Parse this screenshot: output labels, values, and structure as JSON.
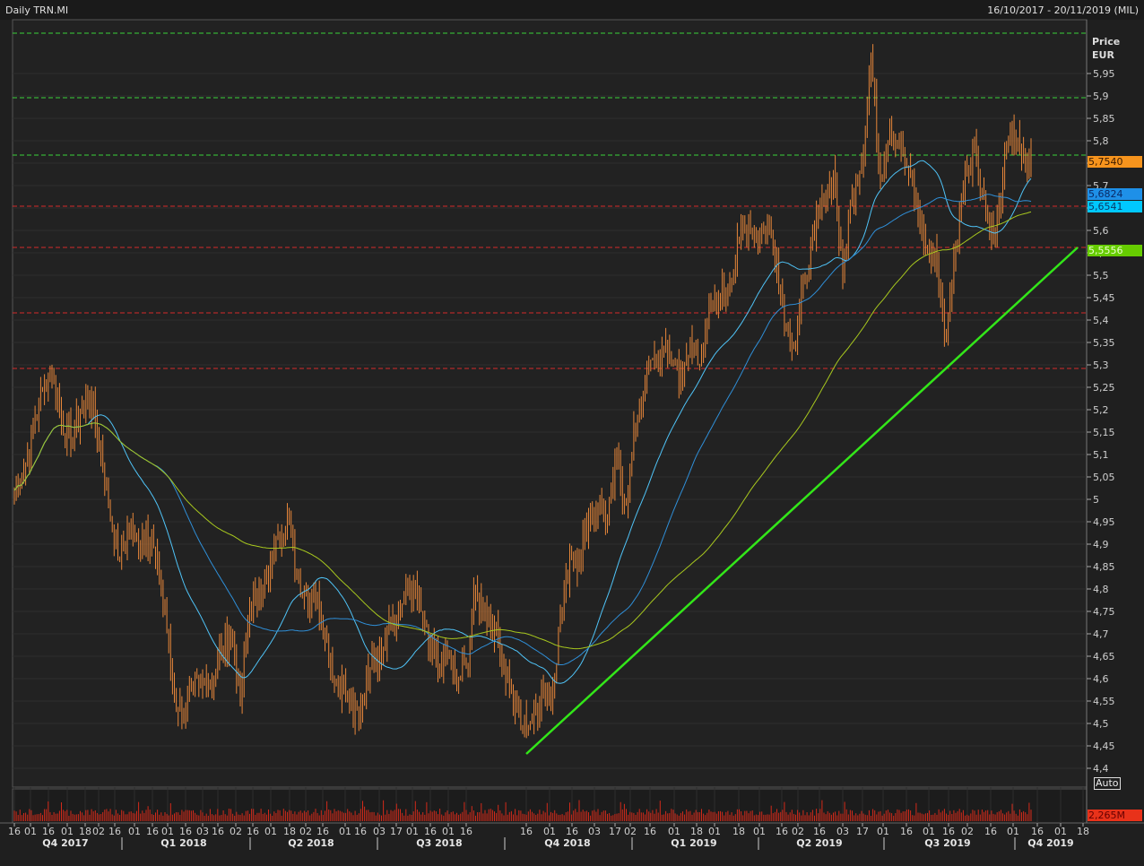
{
  "header": {
    "title": "Daily TRN.MI",
    "range": "16/10/2017 - 20/11/2019 (MIL)"
  },
  "chart_data": {
    "type": "line",
    "title": "Daily TRN.MI",
    "ylabel": "Price",
    "yunit": "EUR",
    "ylim": [
      4.35,
      6.05
    ],
    "yticks": [
      5.95,
      5.9,
      5.85,
      5.8,
      5.75,
      5.7,
      5.65,
      5.6,
      5.55,
      5.5,
      5.45,
      5.4,
      5.35,
      5.3,
      5.25,
      5.2,
      5.15,
      5.1,
      5.05,
      5.0,
      4.95,
      4.9,
      4.85,
      4.8,
      4.75,
      4.7,
      4.65,
      4.6,
      4.55,
      4.5,
      4.45,
      4.4
    ],
    "ytick_labels": [
      "5,95",
      "5,9",
      "5,85",
      "5,8",
      "5,75",
      "5,7",
      "5,65",
      "5,6",
      "5,55",
      "5,5",
      "5,45",
      "5,4",
      "5,35",
      "5,3",
      "5,25",
      "5,2",
      "5,15",
      "5,1",
      "5,05",
      "5",
      "4,95",
      "4,9",
      "4,85",
      "4,8",
      "4,75",
      "4,7",
      "4,65",
      "4,6",
      "4,55",
      "4,5",
      "4,45",
      "4,4"
    ],
    "x_day_labels": [
      "16",
      "01",
      "16",
      "01",
      "18",
      "02",
      "16",
      "01",
      "16",
      "01",
      "16",
      "03",
      "16",
      "02",
      "16",
      "01",
      "18",
      "02",
      "16",
      "01",
      "16",
      "03",
      "17",
      "01",
      "16",
      "01",
      "16",
      "16",
      "01",
      "16",
      "03",
      "17",
      "02",
      "16",
      "01",
      "18",
      "01",
      "18",
      "01",
      "16",
      "02",
      "16",
      "03",
      "17",
      "01",
      "16",
      "01",
      "16",
      "02",
      "16",
      "01",
      "16",
      "01",
      "18"
    ],
    "quarter_labels": [
      "Q4 2017",
      "Q1 2018",
      "Q2 2018",
      "Q3 2018",
      "Q4 2018",
      "Q1 2019",
      "Q2 2019",
      "Q3 2019",
      "Q4 2019"
    ],
    "weekly_close": [
      5.02,
      5.07,
      5.15,
      5.25,
      5.29,
      5.17,
      5.13,
      5.19,
      5.23,
      5.13,
      4.99,
      4.87,
      4.93,
      4.91,
      4.93,
      4.87,
      4.75,
      4.55,
      4.53,
      4.57,
      4.59,
      4.59,
      4.67,
      4.71,
      4.55,
      4.75,
      4.79,
      4.83,
      4.91,
      4.97,
      4.83,
      4.79,
      4.79,
      4.71,
      4.59,
      4.59,
      4.51,
      4.55,
      4.67,
      4.65,
      4.73,
      4.75,
      4.79,
      4.77,
      4.67,
      4.63,
      4.65,
      4.59,
      4.63,
      4.79,
      4.75,
      4.71,
      4.63,
      4.55,
      4.49,
      4.51,
      4.57,
      4.55,
      4.73,
      4.87,
      4.87,
      4.95,
      4.99,
      4.95,
      5.09,
      4.99,
      5.17,
      5.27,
      5.31,
      5.33,
      5.31,
      5.27,
      5.35,
      5.31,
      5.43,
      5.45,
      5.49,
      5.57,
      5.61,
      5.59,
      5.61,
      5.53,
      5.39,
      5.35,
      5.49,
      5.59,
      5.67,
      5.73,
      5.49,
      5.69,
      5.75,
      5.99,
      5.71,
      5.83,
      5.79,
      5.73,
      5.63,
      5.55,
      5.53,
      5.35,
      5.57,
      5.73,
      5.79,
      5.67,
      5.57,
      5.71,
      5.83,
      5.75,
      5.754
    ],
    "support_lines": [
      6.04,
      5.896,
      5.768
    ],
    "resistance_lines": [
      5.654,
      5.562,
      5.416,
      5.292
    ],
    "trendline": {
      "from": {
        "date": "16/11/2018",
        "price": 4.432
      },
      "to": {
        "date": "18/11/2019",
        "price": 5.562
      }
    },
    "last_values": [
      {
        "label": "5,7540",
        "color": "#f7941d",
        "text": "#3a1a00",
        "price": 5.754
      },
      {
        "label": "5,6824",
        "color": "#1e90e8",
        "text": "#0a2a66",
        "price": 5.6824
      },
      {
        "label": "5,6541",
        "color": "#00c8ff",
        "text": "#0a3a66",
        "price": 5.6541
      },
      {
        "label": "5,5556",
        "color": "#66cc00",
        "text": "#eaffd0",
        "price": 5.5556
      }
    ],
    "volume_last": "2,265M",
    "colors": {
      "bars": "#e8873a",
      "ma_short": "#4fc3f7",
      "ma_mid": "#2f8fd8",
      "ma_long": "#a8c81e",
      "trend": "#33e619",
      "volume": "#d42a1a"
    }
  },
  "controls": {
    "auto": "Auto",
    "price_label": "Price",
    "currency_label": "EUR"
  }
}
